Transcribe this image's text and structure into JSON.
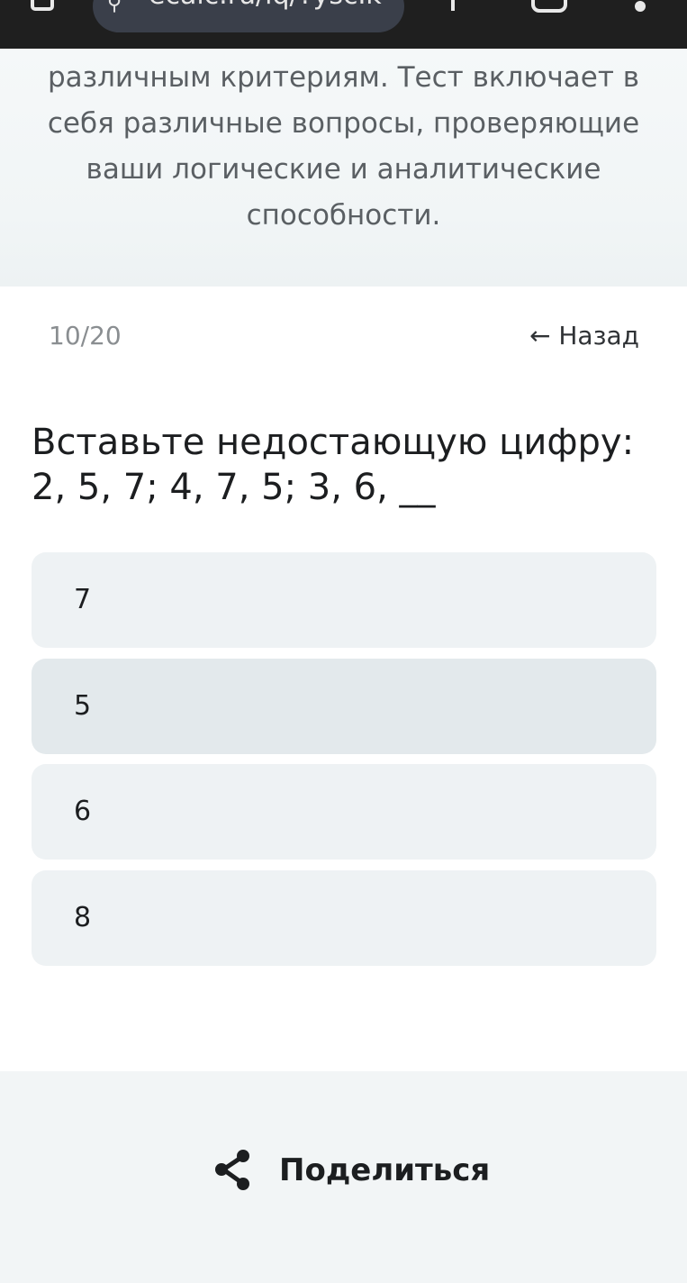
{
  "browser": {
    "url_text": "ecalc.ru/iq/?yscIk"
  },
  "intro": {
    "text": "различным критериям. Тест включает в себя различные вопросы, проверяющие ваши логические и аналитические способности."
  },
  "quiz": {
    "progress": "10/20",
    "back_label": "← Назад",
    "question": "Вставьте недостающую цифру: 2, 5, 7; 4, 7, 5; 3, 6, __",
    "options": [
      {
        "label": "7"
      },
      {
        "label": "5"
      },
      {
        "label": "6"
      },
      {
        "label": "8"
      }
    ]
  },
  "footer": {
    "share_label": "Поделиться"
  },
  "icons": {
    "tab": "tab-icon",
    "site_info": "site-info-icon",
    "new_tab": "plus-icon",
    "tabs_switcher": "tabs-icon",
    "menu": "menu-icon",
    "share": "share-icon"
  },
  "colors": {
    "browser_bar": "#1f1f1f",
    "url_pill": "#3a3f4a",
    "option_bg": "#eef2f4",
    "option_highlight": "#e3e9ec",
    "text_dark": "#1c1e20",
    "text_muted": "#8a8e91"
  }
}
